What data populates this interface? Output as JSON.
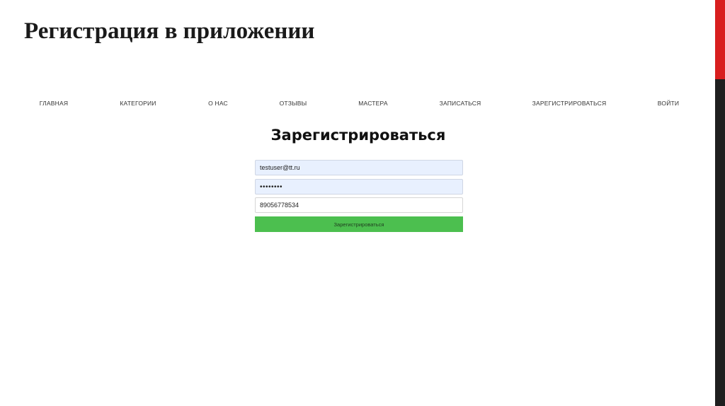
{
  "slide": {
    "title": "Регистрация в приложении"
  },
  "nav": {
    "items": [
      {
        "label": "ГЛАВНАЯ"
      },
      {
        "label": "КАТЕГОРИИ"
      },
      {
        "label": "О НАС"
      },
      {
        "label": "ОТЗЫВЫ"
      },
      {
        "label": "МАСТЕРА"
      },
      {
        "label": "ЗАПИСАТЬСЯ"
      },
      {
        "label": "ЗАРЕГИСТРИРОВАТЬСЯ"
      },
      {
        "label": "ВОЙТИ"
      }
    ]
  },
  "form": {
    "heading": "Зарегистрироваться",
    "email_value": "testuser@tt.ru",
    "password_value": "••••••••",
    "phone_value": "89056778534",
    "submit_label": "Зарегистрироваться"
  },
  "colors": {
    "accent_red": "#d81e1e",
    "edge_dark": "#1f1f1f",
    "autofill_bg": "#e8f0fe",
    "button_green": "#4cbf4f"
  }
}
